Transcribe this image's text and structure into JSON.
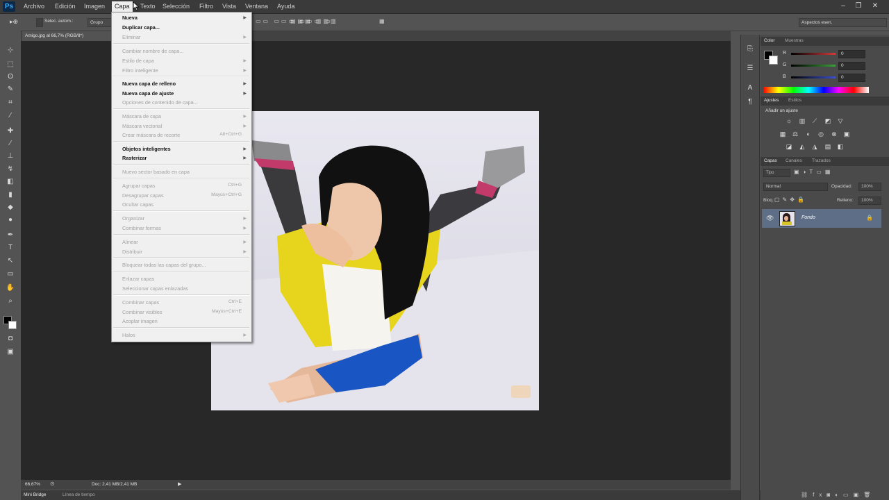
{
  "app": {
    "logo": "Ps"
  },
  "menubar": [
    {
      "label": "Archivo"
    },
    {
      "label": "Edición"
    },
    {
      "label": "Imagen"
    },
    {
      "label": "Capa"
    },
    {
      "label": "Texto"
    },
    {
      "label": "Selección"
    },
    {
      "label": "Filtro"
    },
    {
      "label": "Vista"
    },
    {
      "label": "Ventana"
    },
    {
      "label": "Ayuda"
    }
  ],
  "window_controls": {
    "minimize": "–",
    "restore": "❐",
    "close": "✕"
  },
  "options_bar": {
    "auto_select_label": "Selec. autom.:",
    "auto_select_value": "Grupo",
    "workspace": "Aspectos esen."
  },
  "document": {
    "tab_title": "Amigo.jpg al 66,7% (RGB/8*)"
  },
  "status": {
    "zoom": "66,67%",
    "doc_info": "Doc: 2,41 MB/2,41 MB"
  },
  "bottom_tabs": {
    "tab1": "Mini Bridge",
    "tab2": "Línea de tiempo"
  },
  "color_panel": {
    "tab_color": "Color",
    "tab_swatches": "Muestras",
    "channels": [
      {
        "label": "R",
        "value": "0",
        "color": "#d23a3a"
      },
      {
        "label": "G",
        "value": "0",
        "color": "#3aa03a"
      },
      {
        "label": "B",
        "value": "0",
        "color": "#3a4fd0"
      }
    ]
  },
  "adjustments_panel": {
    "tab_adjust": "Ajustes",
    "tab_styles": "Estilos",
    "heading": "Añadir un ajuste"
  },
  "layers_panel": {
    "tab_layers": "Capas",
    "tab_channels": "Canales",
    "tab_paths": "Trazados",
    "filter_label": "Tipo",
    "blend_mode": "Normal",
    "opacity_label": "Opacidad:",
    "opacity_value": "100%",
    "lock_label": "Bloq.:",
    "fill_label": "Relleno:",
    "fill_value": "100%",
    "layer": {
      "name": "Fondo"
    }
  },
  "layer_menu": {
    "items": [
      {
        "label": "Nueva",
        "shortcut": "",
        "arrow": true,
        "disabled": false,
        "bold": true
      },
      {
        "label": "Duplicar capa...",
        "shortcut": "",
        "arrow": false,
        "disabled": false,
        "bold": true
      },
      {
        "label": "Eliminar",
        "shortcut": "",
        "arrow": true,
        "disabled": true,
        "bold": false
      },
      {
        "label": "Cambiar nombre de capa...",
        "shortcut": "",
        "arrow": false,
        "disabled": true,
        "bold": false
      },
      {
        "label": "Estilo de capa",
        "shortcut": "",
        "arrow": true,
        "disabled": true,
        "bold": false
      },
      {
        "label": "Filtro inteligente",
        "shortcut": "",
        "arrow": true,
        "disabled": true,
        "bold": false
      },
      {
        "label": "Nueva capa de relleno",
        "shortcut": "",
        "arrow": true,
        "disabled": false,
        "bold": true
      },
      {
        "label": "Nueva capa de ajuste",
        "shortcut": "",
        "arrow": true,
        "disabled": false,
        "bold": true
      },
      {
        "label": "Opciones de contenido de capa...",
        "shortcut": "",
        "arrow": false,
        "disabled": true,
        "bold": false
      },
      {
        "label": "Máscara de capa",
        "shortcut": "",
        "arrow": true,
        "disabled": true,
        "bold": false
      },
      {
        "label": "Máscara vectorial",
        "shortcut": "",
        "arrow": true,
        "disabled": true,
        "bold": false
      },
      {
        "label": "Crear máscara de recorte",
        "shortcut": "Alt+Ctrl+G",
        "arrow": false,
        "disabled": true,
        "bold": false
      },
      {
        "label": "Objetos inteligentes",
        "shortcut": "",
        "arrow": true,
        "disabled": false,
        "bold": true
      },
      {
        "label": "Rasterizar",
        "shortcut": "",
        "arrow": true,
        "disabled": false,
        "bold": true
      },
      {
        "label": "Nuevo sector basado en capa",
        "shortcut": "",
        "arrow": false,
        "disabled": true,
        "bold": false
      },
      {
        "label": "Agrupar capas",
        "shortcut": "Ctrl+G",
        "arrow": false,
        "disabled": true,
        "bold": false
      },
      {
        "label": "Desagrupar capas",
        "shortcut": "Mayús+Ctrl+G",
        "arrow": false,
        "disabled": true,
        "bold": false
      },
      {
        "label": "Ocultar capas",
        "shortcut": "",
        "arrow": false,
        "disabled": true,
        "bold": false
      },
      {
        "label": "Organizar",
        "shortcut": "",
        "arrow": true,
        "disabled": true,
        "bold": false
      },
      {
        "label": "Combinar formas",
        "shortcut": "",
        "arrow": true,
        "disabled": true,
        "bold": false
      },
      {
        "label": "Alinear",
        "shortcut": "",
        "arrow": true,
        "disabled": true,
        "bold": false
      },
      {
        "label": "Distribuir",
        "shortcut": "",
        "arrow": true,
        "disabled": true,
        "bold": false
      },
      {
        "label": "Bloquear todas las capas del grupo...",
        "shortcut": "",
        "arrow": false,
        "disabled": true,
        "bold": false
      },
      {
        "label": "Enlazar capas",
        "shortcut": "",
        "arrow": false,
        "disabled": true,
        "bold": false
      },
      {
        "label": "Seleccionar capas enlazadas",
        "shortcut": "",
        "arrow": false,
        "disabled": true,
        "bold": false
      },
      {
        "label": "Combinar capas",
        "shortcut": "Ctrl+E",
        "arrow": false,
        "disabled": true,
        "bold": false
      },
      {
        "label": "Combinar visibles",
        "shortcut": "Mayús+Ctrl+E",
        "arrow": false,
        "disabled": true,
        "bold": false
      },
      {
        "label": "Acoplar imagen",
        "shortcut": "",
        "arrow": false,
        "disabled": true,
        "bold": false
      },
      {
        "label": "Halos",
        "shortcut": "",
        "arrow": true,
        "disabled": true,
        "bold": false
      }
    ]
  }
}
